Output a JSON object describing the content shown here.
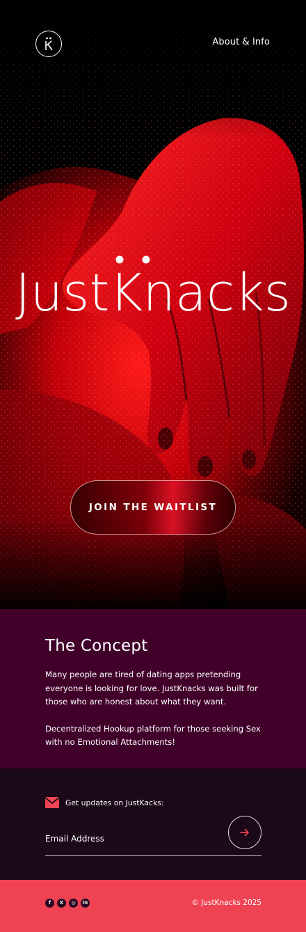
{
  "header": {
    "logo_icon": "k-monogram-icon",
    "nav_link": "About & Info"
  },
  "hero": {
    "brand_name": "JustKnacks",
    "cta_label": "JOIN THE WAITLIST",
    "background": "hand-on-skin-red-photo"
  },
  "concept": {
    "title": "The Concept",
    "paragraph_1": "Many people are tired of dating apps pretending everyone is looking for love. JustKnacks was built for those who are honest about what they want.",
    "paragraph_2": "Decentralized Hookup platform for those seeking Sex with no Emotional Attachments!"
  },
  "newsletter": {
    "icon": "mail-icon",
    "heading": "Get updates on JustKacks:",
    "email_placeholder": "Email Address",
    "submit_icon": "arrow-right-icon"
  },
  "footer": {
    "socials": [
      {
        "name": "facebook-icon",
        "glyph": "f"
      },
      {
        "name": "x-icon",
        "glyph": "X"
      },
      {
        "name": "instagram-icon",
        "glyph": "◎"
      },
      {
        "name": "linkedin-icon",
        "glyph": "in"
      }
    ],
    "copyright": "© JustKnacks 2025"
  },
  "colors": {
    "concept_bg": "#41002a",
    "newsletter_bg": "#1b0818",
    "footer_bg": "#ef4354",
    "accent": "#ef4354"
  }
}
